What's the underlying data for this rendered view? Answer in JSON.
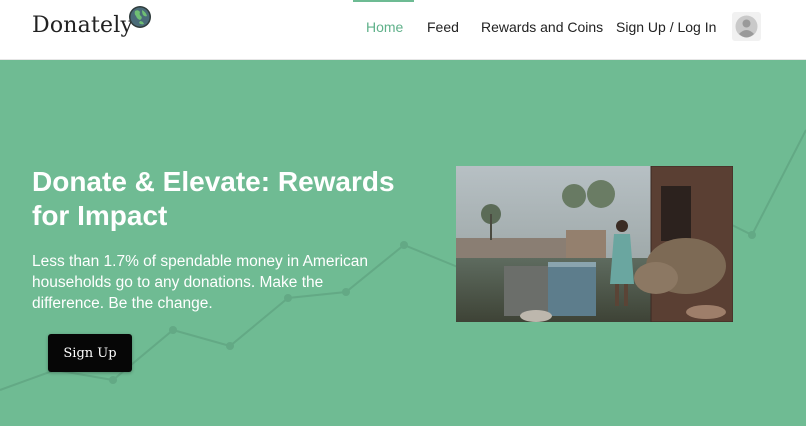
{
  "header": {
    "brand": "Donately",
    "nav": {
      "home": "Home",
      "feed": "Feed",
      "rewards": "Rewards and Coins",
      "signup_login": "Sign Up / Log In"
    },
    "active_item": "Home",
    "icons": {
      "logo": "globe-icon",
      "account": "user-avatar-icon"
    }
  },
  "hero": {
    "title": "Donate & Elevate: Rewards for Impact",
    "text": "Less than 1.7% of spendable money in American households go to any donations. Make the difference. Be the change.",
    "button_label": "Sign Up",
    "photo_alt": "Child standing beside barrels in a village"
  },
  "colors": {
    "accent": "#6fbb93",
    "active_nav": "#5fb18a",
    "button": "#060606",
    "header_bg": "#ffffff"
  }
}
